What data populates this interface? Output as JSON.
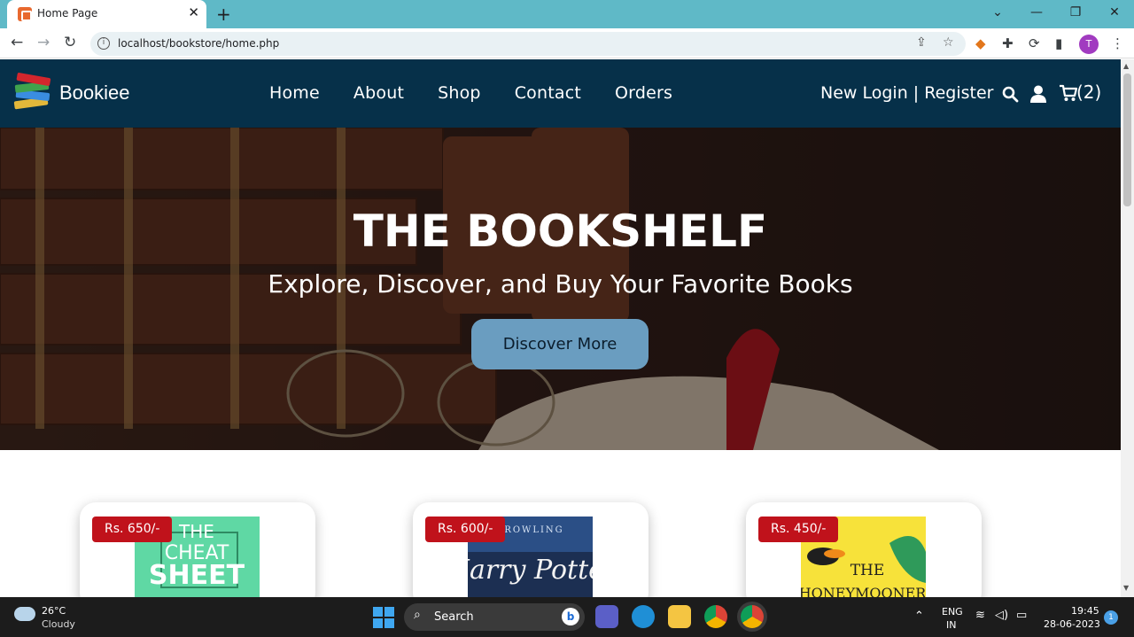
{
  "browser": {
    "tab_title": "Home Page",
    "url": "localhost/bookstore/home.php",
    "profile_initial": "T",
    "tab_close_glyph": "✕",
    "new_tab_glyph": "+",
    "window_controls": [
      "⌄",
      "—",
      "❐",
      "✕"
    ]
  },
  "site": {
    "brand": "Bookiee",
    "nav": [
      "Home",
      "About",
      "Shop",
      "Contact",
      "Orders"
    ],
    "auth_text": "New Login | Register",
    "cart_count": "(2)",
    "header_color": "#063049"
  },
  "hero": {
    "title": "THE BOOKSHELF",
    "subtitle": "Explore, Discover, and Buy Your Favorite Books",
    "cta": "Discover More",
    "cta_color": "#6a9dc0"
  },
  "products": [
    {
      "price": "Rs. 650/-",
      "cover_text": [
        "THE",
        "CHEAT",
        "SHEET"
      ],
      "cover_color": "#5fd8a4"
    },
    {
      "price": "Rs. 600/-",
      "cover_text": [
        "ROWLING",
        "Harry Potter"
      ],
      "cover_color": "#2b4f86"
    },
    {
      "price": "Rs. 450/-",
      "cover_text": [
        "THE",
        "HONEYMOONERS"
      ],
      "cover_color": "#f7e23a"
    }
  ],
  "price_badge_color": "#c0121b",
  "taskbar": {
    "temperature": "26°C",
    "weather": "Cloudy",
    "search_label": "Search",
    "language_line1": "ENG",
    "language_line2": "IN",
    "time": "19:45",
    "date": "28-06-2023",
    "notification_count": "1"
  }
}
